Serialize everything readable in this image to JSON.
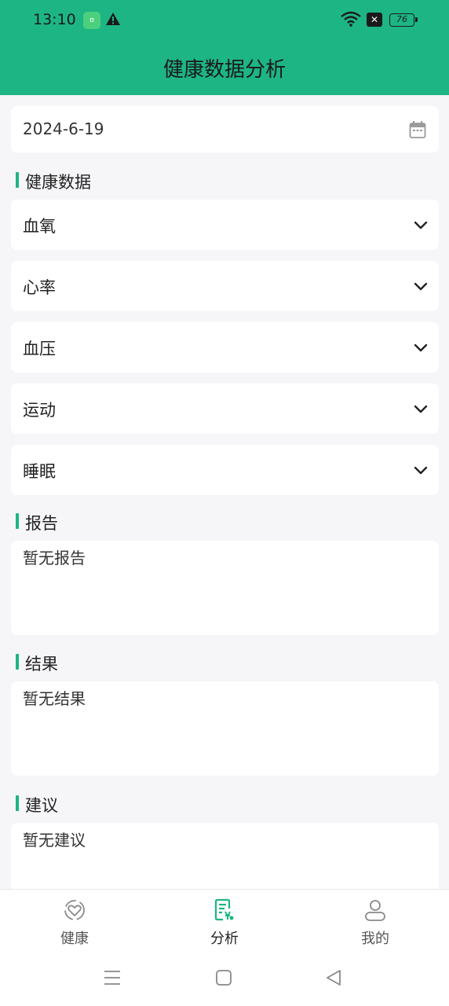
{
  "status_bar": {
    "time": "13:10",
    "battery": "76",
    "icons": [
      "app-notification-icon",
      "warning-icon",
      "wifi-icon",
      "sim-x-icon",
      "battery-icon"
    ]
  },
  "header": {
    "title": "健康数据分析"
  },
  "date_picker": {
    "value": "2024-6-19",
    "icon": "calendar-icon"
  },
  "health_section": {
    "title": "健康数据",
    "items": [
      {
        "label": "血氧"
      },
      {
        "label": "心率"
      },
      {
        "label": "血压"
      },
      {
        "label": "运动"
      },
      {
        "label": "睡眠"
      }
    ]
  },
  "report": {
    "title": "报告",
    "content": "暂无报告"
  },
  "result": {
    "title": "结果",
    "content": "暂无结果"
  },
  "advice": {
    "title": "建议",
    "content": "暂无建议"
  },
  "tabs": [
    {
      "label": "健康",
      "icon": "health-heart-icon",
      "active": false
    },
    {
      "label": "分析",
      "icon": "analysis-document-icon",
      "active": true
    },
    {
      "label": "我的",
      "icon": "profile-user-icon",
      "active": false
    }
  ],
  "colors": {
    "accent": "#1db584",
    "background": "#f6f5f8",
    "card": "#ffffff"
  }
}
